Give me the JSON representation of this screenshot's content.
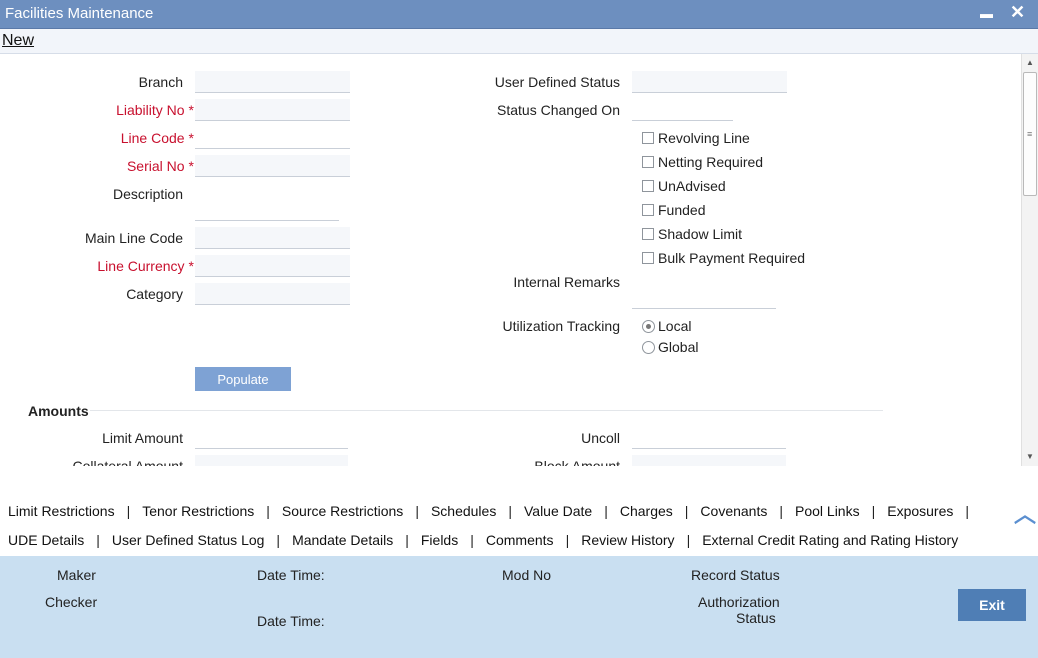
{
  "window": {
    "title": "Facilities Maintenance",
    "minimize": "▬",
    "close": "✕"
  },
  "menu": {
    "new": "New"
  },
  "form": {
    "branch": "Branch",
    "liability_no": "Liability No",
    "line_code": "Line Code",
    "serial_no": "Serial No",
    "description": "Description",
    "main_line_code": "Main Line Code",
    "line_currency": "Line Currency",
    "category": "Category",
    "required_marker": "*",
    "user_defined_status": "User Defined Status",
    "status_changed_on": "Status Changed On",
    "revolving_line": "Revolving Line",
    "netting_required": "Netting Required",
    "unadvised": "UnAdvised",
    "funded": "Funded",
    "shadow_limit": "Shadow Limit",
    "bulk_payment_required": "Bulk Payment Required",
    "internal_remarks": "Internal Remarks",
    "utilization_tracking": "Utilization Tracking",
    "local": "Local",
    "global": "Global",
    "populate": "Populate"
  },
  "amounts": {
    "heading": "Amounts",
    "limit_amount": "Limit Amount",
    "collateral_amount": "Collateral Amount",
    "uncoll": "Uncoll",
    "block_amount": "Block Amount"
  },
  "tabs_row1": [
    "Limit Restrictions",
    "Tenor Restrictions",
    "Source Restrictions",
    "Schedules",
    "Value Date",
    "Charges",
    "Covenants",
    "Pool Links",
    "Exposures"
  ],
  "tabs_row2": [
    "UDE Details",
    "User Defined Status Log",
    "Mandate Details",
    "Fields",
    "Comments",
    "Review History",
    "External Credit Rating and Rating History"
  ],
  "footer": {
    "maker": "Maker",
    "checker": "Checker",
    "date_time_1": "Date Time:",
    "date_time_2": "Date Time:",
    "mod_no": "Mod No",
    "record_status": "Record Status",
    "authorization": "Authorization",
    "status": "Status",
    "exit": "Exit"
  },
  "colors": {
    "titlebar": "#6d8fbf",
    "footer": "#c9dff1",
    "required": "#c8102e",
    "button": "#4f7eb5"
  }
}
